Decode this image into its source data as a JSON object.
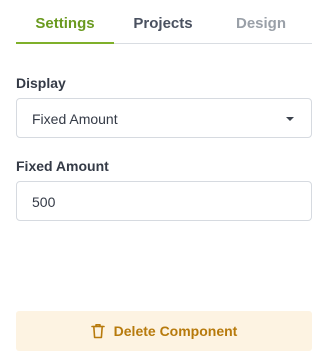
{
  "tabs": [
    {
      "label": "Settings",
      "active": true
    },
    {
      "label": "Projects",
      "active": false
    },
    {
      "label": "Design",
      "active": false
    }
  ],
  "display": {
    "label": "Display",
    "selected": "Fixed Amount",
    "icon": "chevron-down-icon"
  },
  "fixed_amount": {
    "label": "Fixed Amount",
    "value": "500"
  },
  "delete_button": {
    "label": "Delete Component",
    "icon": "trash-icon"
  },
  "colors": {
    "accent": "#7fb02a",
    "warning_text": "#b77a0c",
    "warning_bg": "#fdf3e2"
  }
}
